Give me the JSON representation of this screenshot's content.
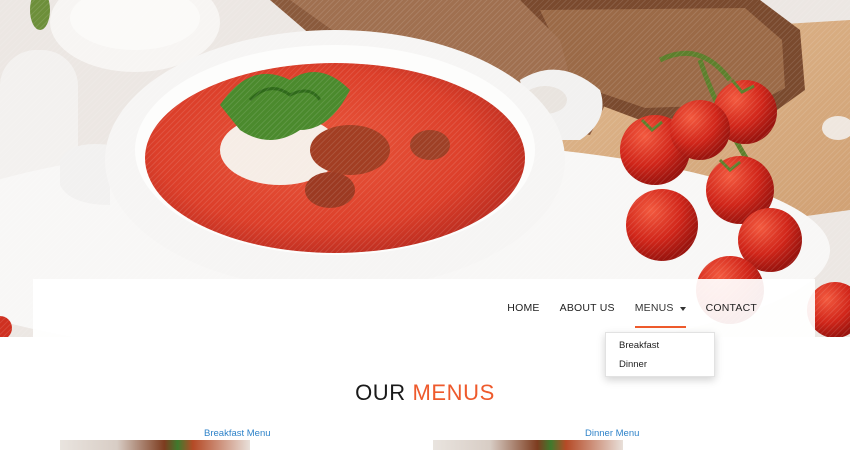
{
  "nav": {
    "items": [
      {
        "label": "HOME"
      },
      {
        "label": "ABOUT US"
      },
      {
        "label": "MENUS"
      },
      {
        "label": "CONTACT"
      }
    ],
    "active": "MENUS",
    "accent_color": "#ee5a2c"
  },
  "dropdown": {
    "items": [
      {
        "label": "Breakfast"
      },
      {
        "label": "Dinner"
      }
    ]
  },
  "section": {
    "title_part1": "OUR",
    "title_part2": "MENUS"
  },
  "menus": [
    {
      "label": "Breakfast Menu"
    },
    {
      "label": "Dinner Menu"
    }
  ],
  "colors": {
    "accent": "#ee5a2c",
    "link": "#2f83c9",
    "text": "#1a1a1a"
  },
  "hero": {
    "image": "tomato-soup-photo"
  }
}
